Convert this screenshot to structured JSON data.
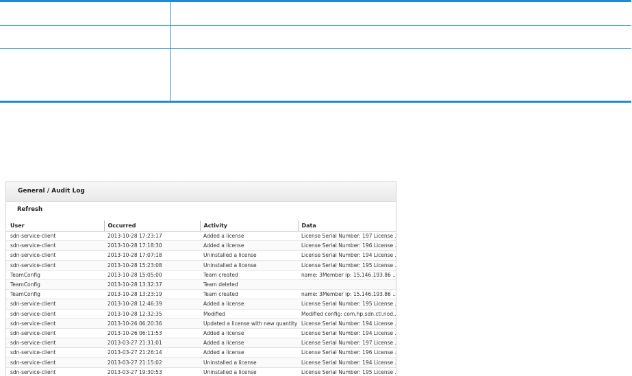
{
  "audit_log": {
    "title": "General / Audit Log",
    "refresh_label": "Refresh",
    "columns": {
      "user": "User",
      "occurred": "Occurred",
      "activity": "Activity",
      "data": "Data"
    },
    "rows": [
      {
        "user": "sdn-service-client",
        "occurred": "2013-10-28 17:23:17",
        "activity": "Added a license",
        "data": "License Serial Number: 197 License ..."
      },
      {
        "user": "sdn-service-client",
        "occurred": "2013-10-28 17:18:30",
        "activity": "Added a license",
        "data": "License Serial Number: 196 License ..."
      },
      {
        "user": "sdn-service-client",
        "occurred": "2013-10-28 17:07:18",
        "activity": "Uninstalled a license",
        "data": "License Serial Number: 194 License ..."
      },
      {
        "user": "sdn-service-client",
        "occurred": "2013-10-28 15:23:08",
        "activity": "Uninstalled a license",
        "data": "License Serial Number: 195 License ..."
      },
      {
        "user": "TeamConfig",
        "occurred": "2013-10-28 15:05:00",
        "activity": "Team created",
        "data": "name: 3Member ip: 15.146.193.86 ..."
      },
      {
        "user": "TeamConfig",
        "occurred": "2013-10-28 13:32:37",
        "activity": "Team deleted",
        "data": ""
      },
      {
        "user": "TeamConfig",
        "occurred": "2013-10-28 13:23:19",
        "activity": "Team created",
        "data": "name: 3Member ip: 15.146.193.86 ..."
      },
      {
        "user": "sdn-service-client",
        "occurred": "2013-10-28 12:46:39",
        "activity": "Added a license",
        "data": "License Serial Number: 195 License ..."
      },
      {
        "user": "sdn-service-client",
        "occurred": "2013-10-28 12:32:35",
        "activity": "Modified",
        "data": "Modified config: com.hp.sdn.ctl.nod..."
      },
      {
        "user": "sdn-service-client",
        "occurred": "2013-10-26 06:20:36",
        "activity": "Updated a license with new quantity",
        "data": "License Serial Number: 194 License ..."
      },
      {
        "user": "sdn-service-client",
        "occurred": "2013-10-26 06:11:53",
        "activity": "Added a license",
        "data": "License Serial Number: 194 License ..."
      },
      {
        "user": "sdn-service-client",
        "occurred": "2013-03-27 21:31:01",
        "activity": "Added a license",
        "data": "License Serial Number: 197 License ..."
      },
      {
        "user": "sdn-service-client",
        "occurred": "2013-03-27 21:26:14",
        "activity": "Added a license",
        "data": "License Serial Number: 196 License ..."
      },
      {
        "user": "sdn-service-client",
        "occurred": "2013-03-27 21:15:02",
        "activity": "Uninstalled a license",
        "data": "License Serial Number: 194 License ..."
      },
      {
        "user": "sdn-service-client",
        "occurred": "2013-03-27 19:30:53",
        "activity": "Uninstalled a license",
        "data": "License Serial Number: 195 License ..."
      }
    ]
  }
}
